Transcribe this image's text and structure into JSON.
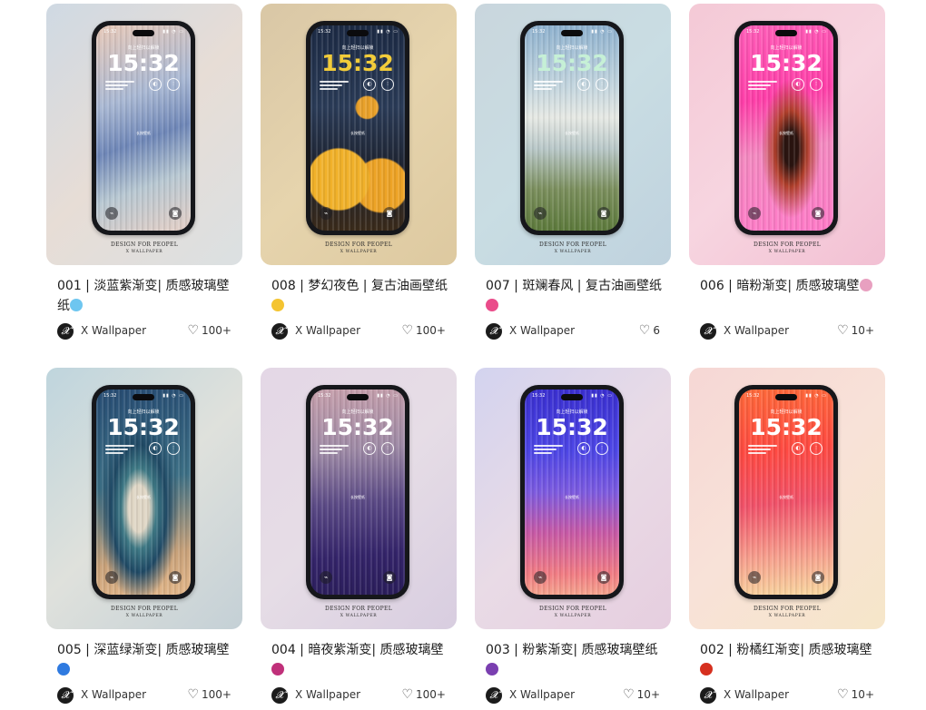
{
  "phone_ui": {
    "lock_hint": "向上轻扫以解锁",
    "clock": "15:32",
    "status_time": "15:32",
    "center_hint": "长按壁纸"
  },
  "cards": [
    {
      "title": "001 | 淡蓝紫渐变| 质感玻璃壁纸",
      "emoji": "💎",
      "author": "X Wallpaper",
      "likes": "100+",
      "brand_line1": "DESIGN FOR PEOPEL",
      "brand_line2": "X WALLPAPER",
      "bg": "linear-gradient(135deg,#cfd9e3 0%,#e7ddd6 50%,#dbe0e2 100%)",
      "screen": "linear-gradient(160deg,#e8c9b8 0%,#aab9d4 35%,#6f87b8 55%,#b8c8d2 75%,#e4cfc6 100%)",
      "clock_class": ""
    },
    {
      "title": "008 | 梦幻夜色 | 复古油画壁纸",
      "emoji": "🌕",
      "author": "X Wallpaper",
      "likes": "100+",
      "brand_line1": "DESIGN FOR PEOPEL",
      "brand_line2": "X WALLPAPER",
      "bg": "linear-gradient(135deg,#d9c7a6 0%,#e6d4ad 50%,#ddc9a0 100%)",
      "screen": "radial-gradient(circle at 30% 75%,#f1b12a 0 18%,transparent 19%),radial-gradient(circle at 75% 78%,#eda326 0 15%,transparent 16%),radial-gradient(circle at 60% 40%,#e9a12a 0 8%,transparent 9%),linear-gradient(180deg,#1c2a44 0%,#2a3b57 40%,#1e2330 70%,#3a2a1a 100%)",
      "clock_class": "gold"
    },
    {
      "title": "007 | 斑斓春风 | 复古油画壁纸",
      "emoji": "🎀",
      "author": "X Wallpaper",
      "likes": "6",
      "brand_line1": "DESIGN FOR PEOPEL",
      "brand_line2": "X WALLPAPER",
      "bg": "linear-gradient(135deg,#c9d6dd 0%,#c9dde3 50%,#bfd2de 100%)",
      "screen": "linear-gradient(180deg,#8fb2cf 0%,#c4d6df 30%,#e6e9e4 45%,#b9c8c9 60%,#7b8f5d 80%,#5d7a3c 100%)",
      "clock_class": "mint"
    },
    {
      "title": "006 | 暗粉渐变| 质感玻璃壁",
      "emoji": "🛍️",
      "author": "X Wallpaper",
      "likes": "10+",
      "brand_line1": "DESIGN FOR PEOPEL",
      "brand_line2": "X WALLPAPER",
      "bg": "linear-gradient(135deg,#f4c9d6 0%,#f7d5e0 50%,#f2c0d3 100%)",
      "screen": "radial-gradient(ellipse at 55% 60%,#2a1410 0 10%,#b2402c 22%,transparent 40%),linear-gradient(170deg,#ff5fb9 0%,#ff3fa9 35%,#f48ac1 60%,#ff7ac8 100%)",
      "clock_class": ""
    },
    {
      "title": "005 | 深蓝绿渐变| 质感玻璃壁",
      "emoji": "🔷",
      "author": "X Wallpaper",
      "likes": "100+",
      "brand_line1": "DESIGN FOR PEOPEL",
      "brand_line2": "X WALLPAPER",
      "bg": "linear-gradient(135deg,#bfd5dd 0%,#dfe1dc 50%,#c4d0d6 100%)",
      "screen": "radial-gradient(ellipse at 45% 58%,#e0d7c6 0 14%,#3f7a86 24%,#204a66 38%,transparent 55%),linear-gradient(170deg,#274c73 0%,#3c6f85 45%,#c9a27a 80%,#e3b78a 100%)",
      "clock_class": ""
    },
    {
      "title": "004 | 暗夜紫渐变| 质感玻璃壁",
      "emoji": "🎇",
      "author": "X Wallpaper",
      "likes": "100+",
      "brand_line1": "DESIGN FOR PEOPEL",
      "brand_line2": "X WALLPAPER",
      "bg": "linear-gradient(135deg,#e4d7e6 0%,#e6dde6 50%,#d8cde0 100%)",
      "screen": "linear-gradient(175deg,#c7a0ac 0%,#9e8aa6 30%,#5b4a86 55%,#34246a 80%,#2a1d5a 100%)",
      "clock_class": ""
    },
    {
      "title": "003 | 粉紫渐变| 质感玻璃壁纸",
      "emoji": "🔮",
      "author": "X Wallpaper",
      "likes": "10+",
      "brand_line1": "DESIGN FOR PEOPEL",
      "brand_line2": "X WALLPAPER",
      "bg": "linear-gradient(135deg,#d3d3ef 0%,#e9dbe6 50%,#e6cedf 100%)",
      "screen": "linear-gradient(180deg,#3a2fd0 0%,#4d46e6 30%,#7d5be0 50%,#c85aa6 70%,#f27d84 90%,#f5a48e 100%)",
      "clock_class": ""
    },
    {
      "title": "002 | 粉橘红渐变| 质感玻璃壁",
      "emoji": "🛑",
      "author": "X Wallpaper",
      "likes": "10+",
      "brand_line1": "DESIGN FOR PEOPEL",
      "brand_line2": "X WALLPAPER",
      "bg": "linear-gradient(135deg,#f6d7d5 0%,#f8e2d8 50%,#f6e6c9 100%)",
      "screen": "linear-gradient(175deg,#ff6a3a 0%,#ff4a42 30%,#f1526a 55%,#f7a08e 80%,#f8d8a0 100%)",
      "clock_class": ""
    }
  ]
}
